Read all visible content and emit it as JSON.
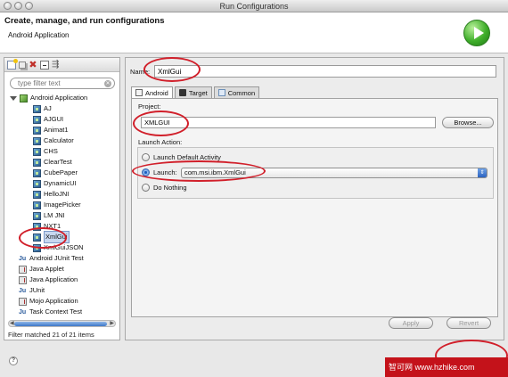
{
  "window": {
    "title": "Run Configurations"
  },
  "header": {
    "title": "Create, manage, and run configurations",
    "subtitle": "Android Application"
  },
  "left": {
    "filter_placeholder": "type filter text",
    "tree": [
      {
        "label": "Android Application",
        "kind": "category"
      },
      {
        "label": "AJ"
      },
      {
        "label": "AJGUI"
      },
      {
        "label": "Animat1"
      },
      {
        "label": "Calculator"
      },
      {
        "label": "CHS"
      },
      {
        "label": "ClearTest"
      },
      {
        "label": "CubePaper"
      },
      {
        "label": "DynamicUI"
      },
      {
        "label": "HelloJNI"
      },
      {
        "label": "ImagePicker"
      },
      {
        "label": "LM JNI"
      },
      {
        "label": "NXT1"
      },
      {
        "label": "XmlGui",
        "selected": true
      },
      {
        "label": "XmlGuiJSON"
      },
      {
        "label": "Android JUnit Test",
        "kind": "category"
      },
      {
        "label": "Java Applet",
        "kind": "category"
      },
      {
        "label": "Java Application",
        "kind": "category"
      },
      {
        "label": "JUnit",
        "kind": "category"
      },
      {
        "label": "Mojo Application",
        "kind": "category"
      },
      {
        "label": "Task Context Test",
        "kind": "category"
      }
    ],
    "filter_status": "Filter matched 21 of 21 items"
  },
  "right": {
    "name_label": "Name:",
    "name_value": "XmlGui",
    "tabs": [
      {
        "label": "Android",
        "icon": "android-icon",
        "active": true
      },
      {
        "label": "Target",
        "icon": "target-icon"
      },
      {
        "label": "Common",
        "icon": "common-icon"
      }
    ],
    "project_label": "Project:",
    "project_value": "XMLGUI",
    "browse_label": "Browse...",
    "launch_action_label": "Launch Action:",
    "options": {
      "default": "Launch Default Activity",
      "launch": "Launch:",
      "nothing": "Do Nothing"
    },
    "launch_activity": "com.msi.ibm.XmlGui",
    "apply_label": "Apply",
    "revert_label": "Revert"
  },
  "watermark": "智可网 www.hzhike.com",
  "colors": {
    "annotation": "#d11f2a",
    "selection": "#c7d7ef",
    "run_green": "#3fae2a"
  }
}
